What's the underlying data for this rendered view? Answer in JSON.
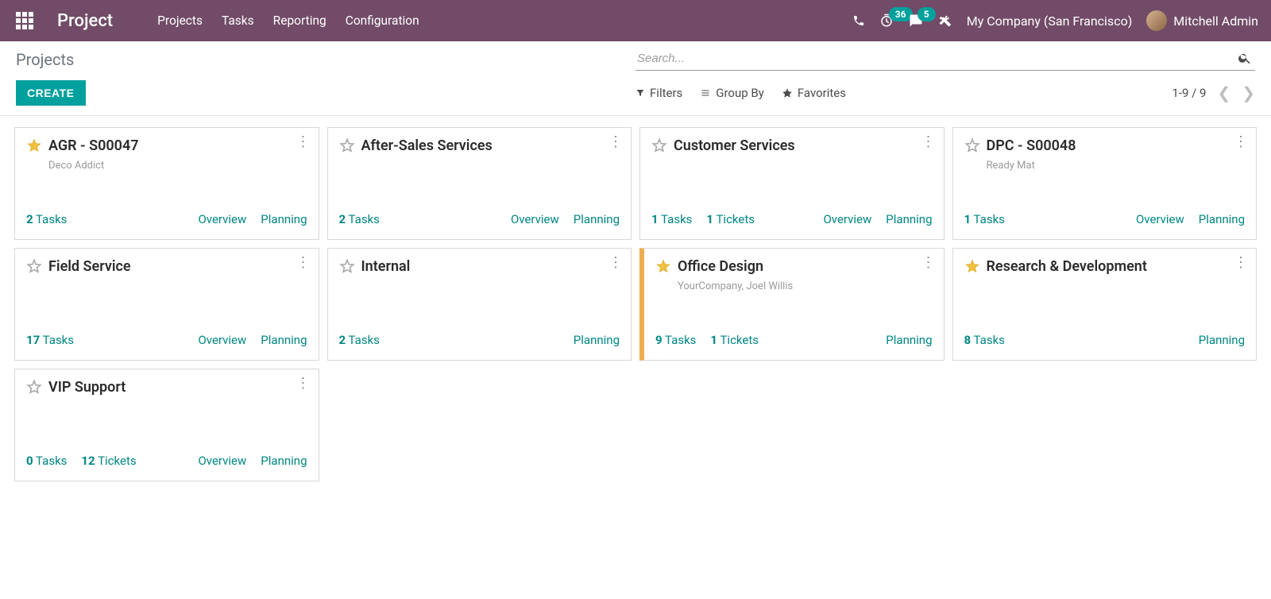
{
  "nav": {
    "brand": "Project",
    "menu": [
      "Projects",
      "Tasks",
      "Reporting",
      "Configuration"
    ],
    "timer_badge": "36",
    "msg_badge": "5",
    "company": "My Company (San Francisco)",
    "user": "Mitchell Admin"
  },
  "control": {
    "breadcrumb": "Projects",
    "create": "CREATE",
    "search_placeholder": "Search...",
    "filters": "Filters",
    "groupby": "Group By",
    "favorites": "Favorites",
    "pager": "1-9 / 9"
  },
  "labels": {
    "tasks": "Tasks",
    "tickets": "Tickets",
    "overview": "Overview",
    "planning": "Planning"
  },
  "projects": [
    {
      "title": "AGR - S00047",
      "subtitle": "Deco Addict",
      "starred": true,
      "accent": "",
      "tasks": 2,
      "tickets": null,
      "overview": true,
      "planning": true
    },
    {
      "title": "After-Sales Services",
      "subtitle": "",
      "starred": false,
      "accent": "",
      "tasks": 2,
      "tickets": null,
      "overview": true,
      "planning": true
    },
    {
      "title": "Customer Services",
      "subtitle": "",
      "starred": false,
      "accent": "",
      "tasks": 1,
      "tickets": 1,
      "overview": true,
      "planning": true
    },
    {
      "title": "DPC - S00048",
      "subtitle": "Ready Mat",
      "starred": false,
      "accent": "",
      "tasks": 1,
      "tickets": null,
      "overview": true,
      "planning": true
    },
    {
      "title": "Field Service",
      "subtitle": "",
      "starred": false,
      "accent": "",
      "tasks": 17,
      "tickets": null,
      "overview": true,
      "planning": true
    },
    {
      "title": "Internal",
      "subtitle": "",
      "starred": false,
      "accent": "",
      "tasks": 2,
      "tickets": null,
      "overview": false,
      "planning": true
    },
    {
      "title": "Office Design",
      "subtitle": "YourCompany, Joel Willis",
      "starred": true,
      "accent": "yellow",
      "tasks": 9,
      "tickets": 1,
      "overview": false,
      "planning": true
    },
    {
      "title": "Research & Development",
      "subtitle": "",
      "starred": true,
      "accent": "",
      "tasks": 8,
      "tickets": null,
      "overview": false,
      "planning": true
    },
    {
      "title": "VIP Support",
      "subtitle": "",
      "starred": false,
      "accent": "",
      "tasks": 0,
      "tickets": 12,
      "overview": true,
      "planning": true
    }
  ]
}
